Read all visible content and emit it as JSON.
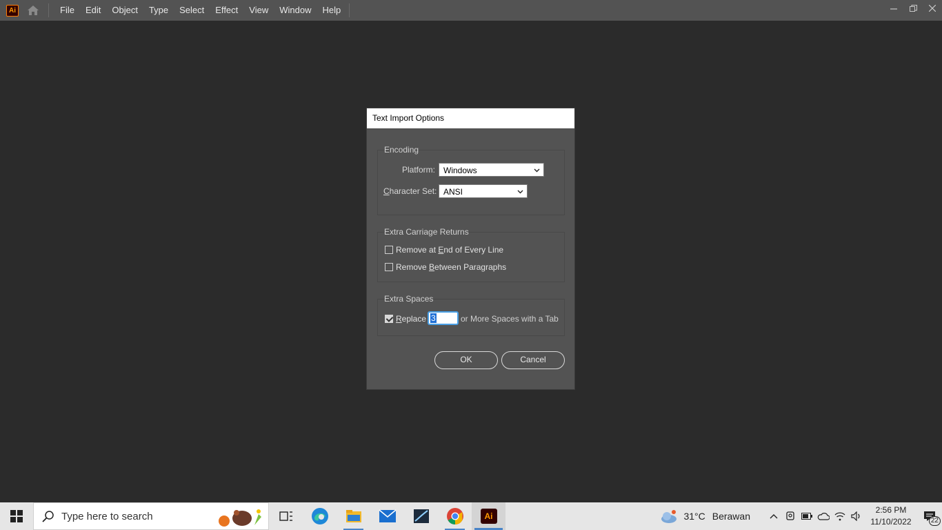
{
  "app": {
    "logo_text": "Ai",
    "menu": [
      "File",
      "Edit",
      "Object",
      "Type",
      "Select",
      "Effect",
      "View",
      "Window",
      "Help"
    ]
  },
  "dialog": {
    "title": "Text Import Options",
    "encoding": {
      "group_label": "Encoding",
      "platform_label": "Platform:",
      "platform_value": "Windows",
      "charset_label_pre": "C",
      "charset_label_rest": "haracter Set:",
      "charset_value": "ANSI"
    },
    "carriage": {
      "group_label": "Extra Carriage Returns",
      "remove_end_pre": "Remove at ",
      "remove_end_u": "E",
      "remove_end_post": "nd of Every Line",
      "remove_end_checked": false,
      "remove_between_pre": "Remove ",
      "remove_between_u": "B",
      "remove_between_post": "etween Paragraphs",
      "remove_between_checked": false
    },
    "spaces": {
      "group_label": "Extra Spaces",
      "replace_u": "R",
      "replace_rest": "eplace",
      "replace_checked": true,
      "count_value": "3",
      "suffix": "or More Spaces with a Tab"
    },
    "ok_label": "OK",
    "cancel_label": "Cancel"
  },
  "taskbar": {
    "search_placeholder": "Type here to search",
    "weather_temp": "31°C",
    "weather_desc": "Berawan",
    "time": "2:56 PM",
    "date": "11/10/2022",
    "notification_count": "22",
    "ai_label": "Ai"
  }
}
